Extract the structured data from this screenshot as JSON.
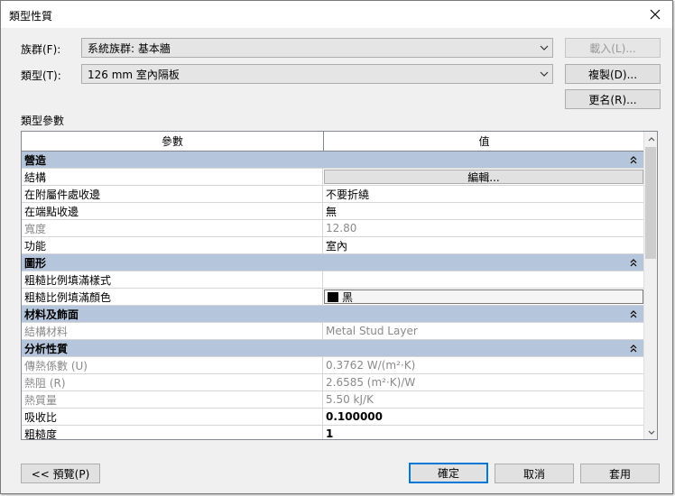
{
  "window": {
    "title": "類型性質"
  },
  "family": {
    "label": "族群(F):",
    "value": "系統族群: 基本牆"
  },
  "type": {
    "label": "類型(T):",
    "value": "126 mm 室內隔板"
  },
  "buttons": {
    "load": "載入(L)...",
    "duplicate": "複製(D)...",
    "rename": "更名(R)...",
    "preview": "<< 預覽(P)",
    "ok": "確定",
    "cancel": "取消",
    "apply": "套用"
  },
  "params_section": "類型參數",
  "grid": {
    "headers": [
      "參數",
      "值"
    ],
    "groups": [
      {
        "name": "營造",
        "rows": [
          {
            "param": "結構",
            "value": "編輯..."
          },
          {
            "param": "在附屬件處收邊",
            "value": "不要折繞"
          },
          {
            "param": "在端點收邊",
            "value": "無"
          },
          {
            "param": "寬度",
            "value": "12.80"
          },
          {
            "param": "功能",
            "value": "室內"
          }
        ]
      },
      {
        "name": "圖形",
        "rows": [
          {
            "param": "粗糙比例填滿樣式",
            "value": ""
          },
          {
            "param": "粗糙比例填滿顏色",
            "value": "黑"
          }
        ]
      },
      {
        "name": "材料及飾面",
        "rows": [
          {
            "param": "結構材料",
            "value": "Metal Stud Layer"
          }
        ]
      },
      {
        "name": "分析性質",
        "rows": [
          {
            "param": "傳熱係數 (U)",
            "value": "0.3762 W/(m²·K)"
          },
          {
            "param": "熱阻 (R)",
            "value": "2.6585 (m²·K)/W"
          },
          {
            "param": "熱質量",
            "value": "5.50 kJ/K"
          },
          {
            "param": "吸收比",
            "value": "0.100000"
          },
          {
            "param": "粗糙度",
            "value": "1"
          }
        ]
      }
    ]
  },
  "colors": {
    "group_header": "#b5c5db",
    "accent": "#0078d7"
  }
}
